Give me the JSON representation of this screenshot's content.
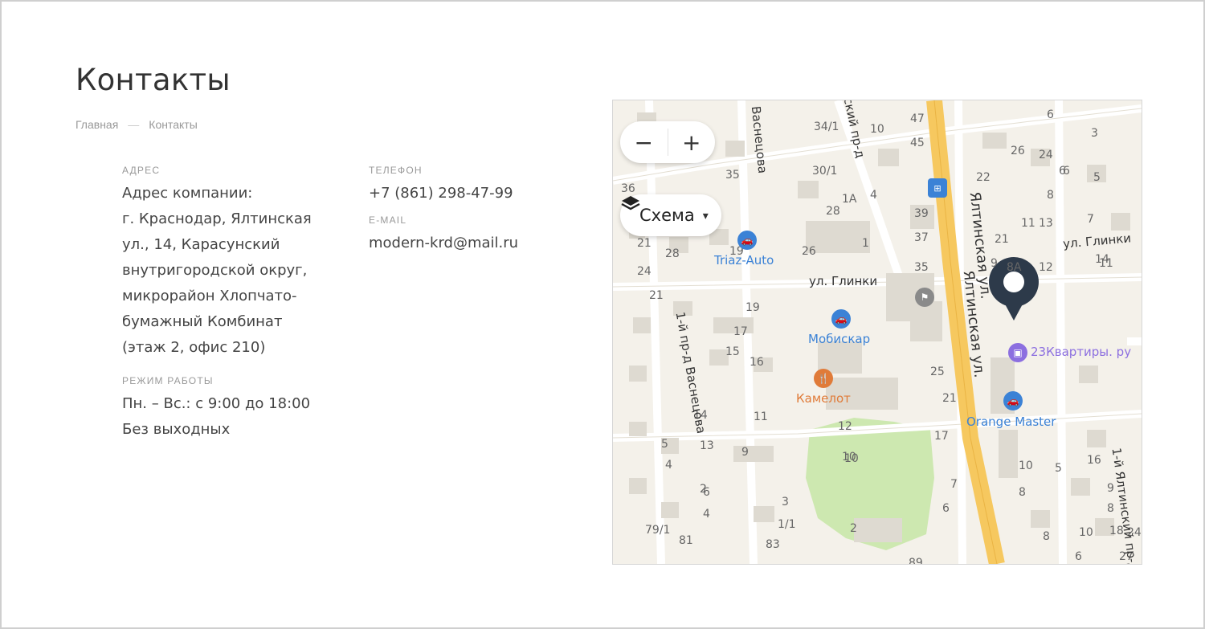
{
  "page": {
    "title": "Контакты",
    "breadcrumb": {
      "home": "Главная",
      "separator": "—",
      "current": "Контакты"
    }
  },
  "contacts": {
    "address": {
      "label": "Адрес",
      "lines": [
        "Адрес компании:",
        "г. Краснодар, Ялтинская",
        "ул., 14, Карасунский",
        "внутригородской округ,",
        "микрорайон Хлопчато-",
        "бумажный Комбинат",
        "(этаж 2, офис 210)"
      ]
    },
    "hours": {
      "label": "Режим работы",
      "lines": [
        "Пн. – Вс.: с 9:00 до 18:00",
        "Без выходных"
      ]
    },
    "phone": {
      "label": "Телефон",
      "value": "+7 (861) 298-47-99"
    },
    "email": {
      "label": "E-mail",
      "value": "modern-krd@mail.ru"
    }
  },
  "map": {
    "zoom_out": "−",
    "zoom_in": "+",
    "layer_label": "Схема",
    "layer_caret": "▾",
    "streets": {
      "glinki_left": "ул. Глинки",
      "glinki_right": "ул. Глинки",
      "yaltinskaya_1": "Ялтинская ул.",
      "yaltinskaya_2": "Ялтинская ул.",
      "vasnetsova": "Васнецова",
      "vasnetsova_pr": "1-й пр-д Васнецова",
      "yaltinsky_pr": "1-й Ялтинский пр-д",
      "sky_pr": "ский пр-д"
    },
    "pois": {
      "triaz": "Triaz-Auto",
      "mobiskar": "Мобискар",
      "kamelot": "Камелот",
      "kvartiry": "23Квартиры. ру",
      "orange": "Orange Master"
    },
    "house_numbers": [
      "34/1",
      "10",
      "47",
      "6",
      "3",
      "45",
      "24",
      "26",
      "35",
      "30/1",
      "6",
      "22",
      "5",
      "6",
      "36",
      "1А",
      "4",
      "39",
      "8",
      "28",
      "37",
      "11",
      "13",
      "7",
      "21",
      "28",
      "26",
      "1",
      "9",
      "21",
      "19",
      "35",
      "8А",
      "12",
      "14",
      "11",
      "24",
      "21",
      "19",
      "17",
      "15",
      "16",
      "25",
      "21",
      "14",
      "11",
      "12",
      "10",
      "17",
      "13",
      "10",
      "9",
      "5",
      "4",
      "2",
      "6",
      "4",
      "3",
      "1/1",
      "83",
      "79/1",
      "81",
      "2",
      "10",
      "8",
      "7",
      "6",
      "8",
      "5",
      "16",
      "9",
      "8",
      "18",
      "10",
      "6",
      "24",
      "27",
      "89"
    ],
    "colors": {
      "marker": "#2d3a4a",
      "road": "#f6c85f",
      "park": "#cde8b0"
    }
  }
}
